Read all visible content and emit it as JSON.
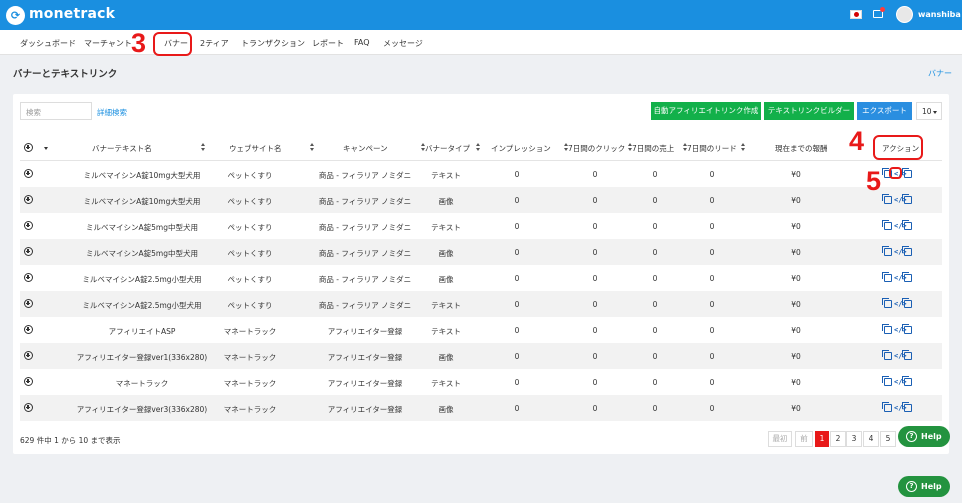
{
  "header": {
    "brand": "monetrack",
    "user": "wanshiba"
  },
  "nav": [
    "ダッシュボード",
    "マーチャント",
    "バナー",
    "2ティア",
    "トランザクション",
    "レポート",
    "FAQ",
    "メッセージ"
  ],
  "annotations": {
    "m3": "3",
    "m4": "4",
    "m5": "5"
  },
  "page": {
    "title": "バナーとテキストリンク",
    "breadcrumb": "バナー"
  },
  "toolbar": {
    "search_placeholder": "検索",
    "advanced_search": "詳細検索",
    "auto_link": "自動アフィリエイトリンク作成",
    "text_link_builder": "テキストリンクビルダー",
    "export": "エクスポート",
    "per_page": "10"
  },
  "table": {
    "columns": [
      "バナーテキスト名",
      "ウェブサイト名",
      "キャンペーン",
      "バナータイプ",
      "インプレッション",
      "7日間のクリック",
      "7日間の売上",
      "7日間のリード",
      "現在までの報酬",
      "アクション"
    ],
    "rows": [
      {
        "name": "ミルベマイシンA錠10mg大型犬用",
        "site": "ペットくすり",
        "campaign": "商品 - フィラリア ノミダニ",
        "type": "テキスト",
        "impressions": "0",
        "clicks": "0",
        "sales": "0",
        "leads": "0",
        "reward": "¥0"
      },
      {
        "name": "ミルベマイシンA錠10mg大型犬用",
        "site": "ペットくすり",
        "campaign": "商品 - フィラリア ノミダニ",
        "type": "画像",
        "impressions": "0",
        "clicks": "0",
        "sales": "0",
        "leads": "0",
        "reward": "¥0"
      },
      {
        "name": "ミルベマイシンA錠5mg中型犬用",
        "site": "ペットくすり",
        "campaign": "商品 - フィラリア ノミダニ",
        "type": "テキスト",
        "impressions": "0",
        "clicks": "0",
        "sales": "0",
        "leads": "0",
        "reward": "¥0"
      },
      {
        "name": "ミルベマイシンA錠5mg中型犬用",
        "site": "ペットくすり",
        "campaign": "商品 - フィラリア ノミダニ",
        "type": "画像",
        "impressions": "0",
        "clicks": "0",
        "sales": "0",
        "leads": "0",
        "reward": "¥0"
      },
      {
        "name": "ミルベマイシンA錠2.5mg小型犬用",
        "site": "ペットくすり",
        "campaign": "商品 - フィラリア ノミダニ",
        "type": "画像",
        "impressions": "0",
        "clicks": "0",
        "sales": "0",
        "leads": "0",
        "reward": "¥0"
      },
      {
        "name": "ミルベマイシンA錠2.5mg小型犬用",
        "site": "ペットくすり",
        "campaign": "商品 - フィラリア ノミダニ",
        "type": "テキスト",
        "impressions": "0",
        "clicks": "0",
        "sales": "0",
        "leads": "0",
        "reward": "¥0"
      },
      {
        "name": "アフィリエイトASP",
        "site": "マネートラック",
        "campaign": "アフィリエイター登録",
        "type": "テキスト",
        "impressions": "0",
        "clicks": "0",
        "sales": "0",
        "leads": "0",
        "reward": "¥0"
      },
      {
        "name": "アフィリエイター登録ver1(336x280)",
        "site": "マネートラック",
        "campaign": "アフィリエイター登録",
        "type": "画像",
        "impressions": "0",
        "clicks": "0",
        "sales": "0",
        "leads": "0",
        "reward": "¥0"
      },
      {
        "name": "マネートラック",
        "site": "マネートラック",
        "campaign": "アフィリエイター登録",
        "type": "テキスト",
        "impressions": "0",
        "clicks": "0",
        "sales": "0",
        "leads": "0",
        "reward": "¥0"
      },
      {
        "name": "アフィリエイター登録ver3(336x280)",
        "site": "マネートラック",
        "campaign": "アフィリエイター登録",
        "type": "画像",
        "impressions": "0",
        "clicks": "0",
        "sales": "0",
        "leads": "0",
        "reward": "¥0"
      }
    ]
  },
  "footer": {
    "summary": "629 件中 1 から 10 まで表示",
    "first": "最初",
    "prev": "前",
    "pages": [
      "1",
      "2",
      "3",
      "4",
      "5"
    ],
    "current_page": "1"
  },
  "help": {
    "label": "Help"
  },
  "colors": {
    "primary": "#1a8fe0",
    "green": "#12b04a",
    "annotation_red": "#e81919",
    "help_green": "#23933f"
  }
}
